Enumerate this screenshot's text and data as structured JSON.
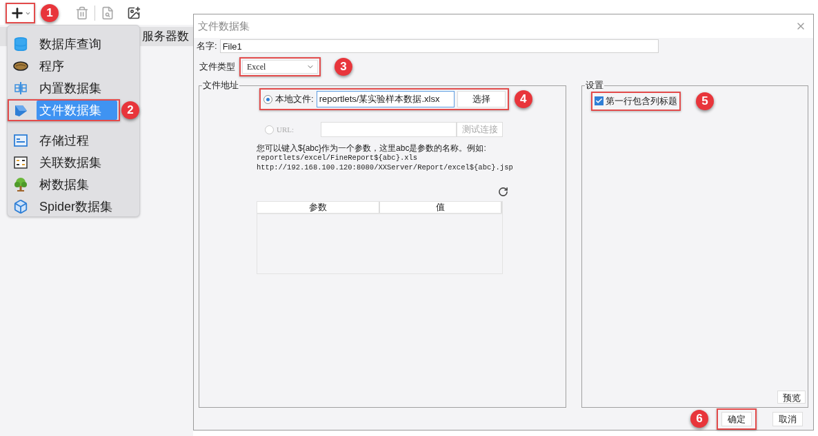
{
  "toolbar": {
    "add_button": {
      "highlighted": true,
      "callout": "1"
    }
  },
  "menu": {
    "items": [
      {
        "kind": "database",
        "label": "数据库查询",
        "selected": false,
        "highlighted": false
      },
      {
        "kind": "program",
        "label": "程序",
        "selected": false,
        "highlighted": false
      },
      {
        "kind": "builtin",
        "label": "内置数据集",
        "selected": false,
        "highlighted": false
      },
      {
        "kind": "file",
        "label": "文件数据集",
        "selected": true,
        "highlighted": true,
        "callout": "2"
      },
      {
        "kind": "procedure",
        "label": "存储过程",
        "selected": false,
        "highlighted": false
      },
      {
        "kind": "relation",
        "label": "关联数据集",
        "selected": false,
        "highlighted": false
      },
      {
        "kind": "tree",
        "label": "树数据集",
        "selected": false,
        "highlighted": false
      },
      {
        "kind": "spider",
        "label": "Spider数据集",
        "selected": false,
        "highlighted": false
      }
    ]
  },
  "background_tab": {
    "label": "服务器数"
  },
  "dialog": {
    "title": "文件数据集",
    "name": {
      "label": "名字:",
      "value": "File1"
    },
    "file_type": {
      "label": "文件类型",
      "value": "Excel",
      "highlighted": true,
      "callout": "3"
    },
    "address": {
      "legend": "文件地址",
      "local": {
        "label": "本地文件:",
        "value": "reportlets/某实验样本数据.xlsx",
        "button": "选择",
        "selected": true,
        "highlighted": true,
        "callout": "4"
      },
      "url": {
        "label": "URL:",
        "button": "测试连接",
        "selected": false,
        "disabled": true
      },
      "hint_lines": [
        "您可以键入${abc}作为一个参数，这里abc是参数的名称。例如:",
        "reportlets/excel/FineReport${abc}.xls",
        "http://192.168.100.120:8080/XXServer/Report/excel${abc}.jsp"
      ],
      "table": {
        "columns": [
          "参数",
          "值"
        ]
      }
    },
    "settings": {
      "legend": "设置",
      "first_row_header": {
        "label": "第一行包含列标题",
        "checked": true,
        "highlighted": true,
        "callout": "5"
      },
      "preview_button": "预览"
    },
    "buttons": [
      {
        "label": "确定",
        "highlighted": true,
        "callout": "6"
      },
      {
        "label": "取消",
        "highlighted": false
      }
    ]
  }
}
